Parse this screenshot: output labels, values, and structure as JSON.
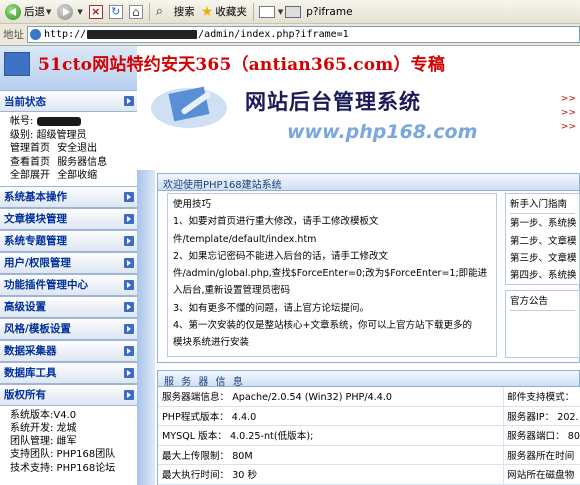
{
  "toolbar": {
    "back_label": "后退",
    "search_label": "搜索",
    "favorites_label": "收藏夹",
    "iframe_label": "p?iframe"
  },
  "address": {
    "label": "地址",
    "url_prefix": "http://",
    "url_suffix": "/admin/index.php?iframe=1"
  },
  "headline": "51cto网站特约安天365（antian365.com）专稿",
  "banner": {
    "title": "网站后台管理系统",
    "url": "www.php168.com",
    "side_marks": [
      ">>",
      ">>",
      ">>"
    ]
  },
  "sidebar": {
    "current_status": {
      "heading": "当前状态",
      "account_label": "帐号:",
      "level": "级别: 超级管理员",
      "links_row1": [
        "管理首页",
        "安全退出"
      ],
      "links_row2": [
        "查看首页",
        "服务器信息"
      ],
      "links_row3": [
        "全部展开",
        "全部收缩"
      ]
    },
    "sections": [
      "系统基本操作",
      "文章模块管理",
      "系统专题管理",
      "用户/权限管理",
      "功能插件管理中心",
      "高级设置",
      "风格/模板设置",
      "数据采集器",
      "数据库工具"
    ],
    "copyright": {
      "heading": "版权所有",
      "lines": [
        "系统版本:V4.0",
        "系统开发: 龙城",
        "团队管理: 雌军",
        "支持团队: PHP168团队",
        "技术支持: PHP168论坛"
      ]
    }
  },
  "welcome": {
    "title": "欢迎使用PHP168建站系统",
    "tips_heading": "使用技巧",
    "tips": [
      "1、如要对首页进行重大修改，请手工修改模板文",
      "件/template/default/index.htm",
      "2、如果忘记密码不能进入后台的话，请手工修改文",
      "件/admin/global.php,查找$ForceEnter=0;改为$ForceEnter=1;即能进",
      "入后台,重新设置管理员密码",
      "3、如有更多不懂的问题，请上官方论坛提问。",
      "4、第一次安装的仅是整站核心+文章系统，你可以上官方站下载更多的",
      "模块系统进行安装"
    ],
    "guide_heading": "新手入门指南",
    "guide_items": [
      "第一步、系统换",
      "第二步、文章模",
      "第三步、文章模",
      "第四步、系统换"
    ],
    "notice_heading": "官方公告"
  },
  "server_info": {
    "title": "服 务 器 信 息",
    "rows": [
      {
        "left": "服务器端信息： Apache/2.0.54 (Win32) PHP/4.4.0",
        "right": "邮件支持模式："
      },
      {
        "left": "PHP程式版本： 4.4.0",
        "right": "服务器IP： 202."
      },
      {
        "left": "MYSQL 版本： 4.0.25-nt(低版本);",
        "right": "服务器端口： 80"
      },
      {
        "left": "最大上传限制： 80M",
        "right": "服务器所在时间"
      },
      {
        "left": "最大执行时间： 30 秒",
        "right": "网站所在磁盘物"
      }
    ]
  },
  "colors": {
    "headline_red": "#d40000",
    "sidebar_blue": "#00309c",
    "panel_border": "#8fb0dd"
  }
}
